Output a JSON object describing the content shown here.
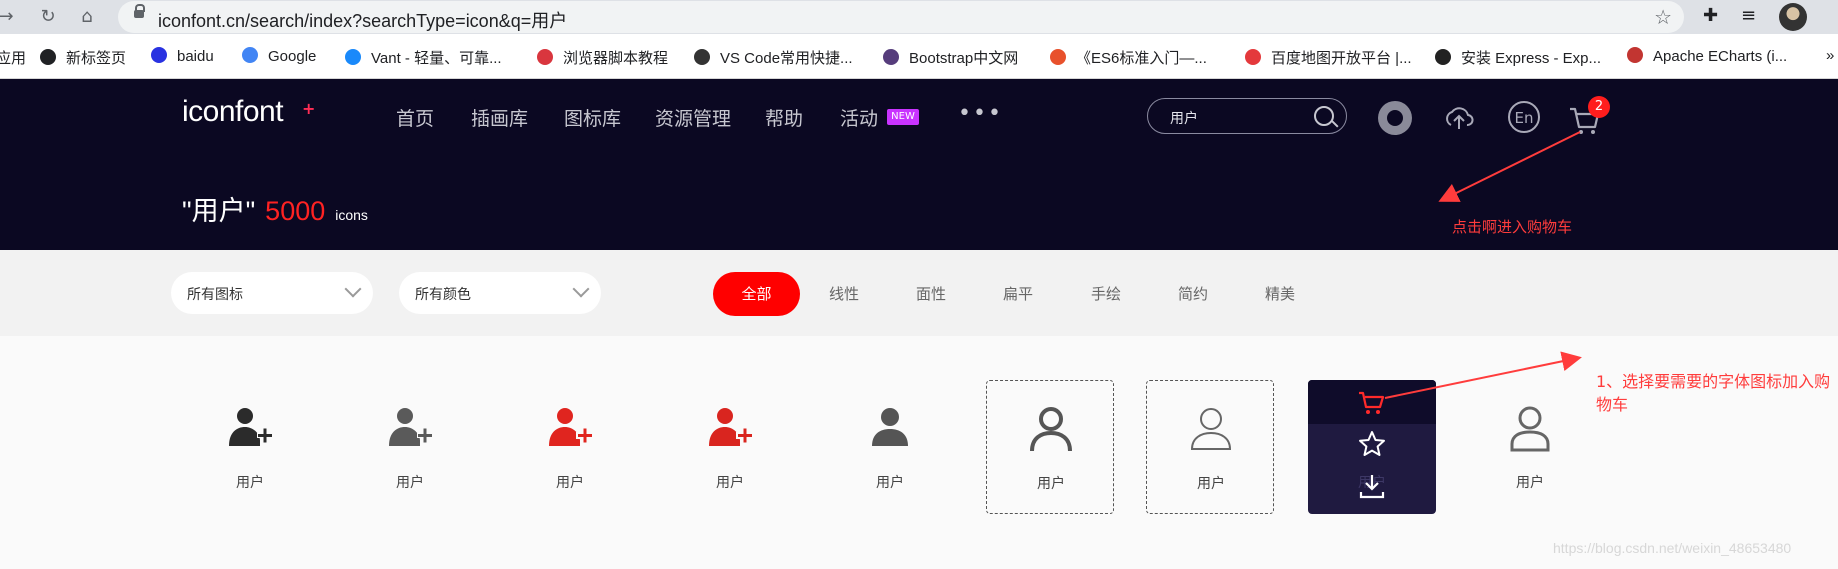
{
  "browser": {
    "url": "iconfont.cn/search/index?searchType=icon&q=用户",
    "bookmarks_overflow": "»",
    "bookmarks": [
      {
        "label": "应用",
        "icon_color": "#5f6368"
      },
      {
        "label": "新标签页",
        "icon_color": "#202124"
      },
      {
        "label": "baidu",
        "icon_color": "#2932e1"
      },
      {
        "label": "Google",
        "icon_color": "#4285f4"
      },
      {
        "label": "Vant - 轻量、可靠...",
        "icon_color": "#1989fa"
      },
      {
        "label": "浏览器脚本教程",
        "icon_color": "#d9363e"
      },
      {
        "label": "VS Code常用快捷...",
        "icon_color": "#333333"
      },
      {
        "label": "Bootstrap中文网",
        "icon_color": "#563d7c"
      },
      {
        "label": "《ES6标准入门—...",
        "icon_color": "#e8512c"
      },
      {
        "label": "百度地图开放平台 |...",
        "icon_color": "#e4393c"
      },
      {
        "label": "安装 Express - Exp...",
        "icon_color": "#222222"
      },
      {
        "label": "Apache ECharts (i...",
        "icon_color": "#c23531"
      }
    ]
  },
  "header": {
    "logo": "iconfont",
    "nav": [
      "首页",
      "插画库",
      "图标库",
      "资源管理",
      "帮助",
      "活动"
    ],
    "new_badge": "NEW",
    "more": "•••",
    "search_value": "用户",
    "en_label": "En",
    "cart_count": "2",
    "result_query": "\"用户\"",
    "result_count": "5000",
    "result_unit": "icons",
    "annotation_cart": "点击啊进入购物车"
  },
  "filters": {
    "dropdowns": [
      "所有图标",
      "所有颜色"
    ],
    "styles": [
      "全部",
      "线性",
      "面性",
      "扁平",
      "手绘",
      "简约",
      "精美"
    ],
    "active_style": "全部"
  },
  "icons": [
    {
      "label": "用户",
      "kind": "user-plus",
      "color": "#2b2b2b"
    },
    {
      "label": "用户",
      "kind": "user-plus",
      "color": "#5a5a5a"
    },
    {
      "label": "用户",
      "kind": "user-plus",
      "color": "#e0251f"
    },
    {
      "label": "用户",
      "kind": "user-plus",
      "color": "#d9251f"
    },
    {
      "label": "用户",
      "kind": "user-solid",
      "color": "#555555"
    },
    {
      "label": "用户",
      "kind": "user-outline-bold",
      "color": "#555555"
    },
    {
      "label": "用户",
      "kind": "user-outline-thin",
      "color": "#666666"
    },
    {
      "label": "用户",
      "kind": "hover-actions",
      "color": "#ffffff"
    },
    {
      "label": "用户",
      "kind": "user-outline-round",
      "color": "#666666"
    }
  ],
  "annotation_step": "1、选择要需要的字体图标加入购物车",
  "watermark": "https://blog.csdn.net/weixin_48653480",
  "colors": {
    "header_bg": "#0b0822",
    "accent": "#ff0000",
    "annotation": "#ff3c3c"
  }
}
